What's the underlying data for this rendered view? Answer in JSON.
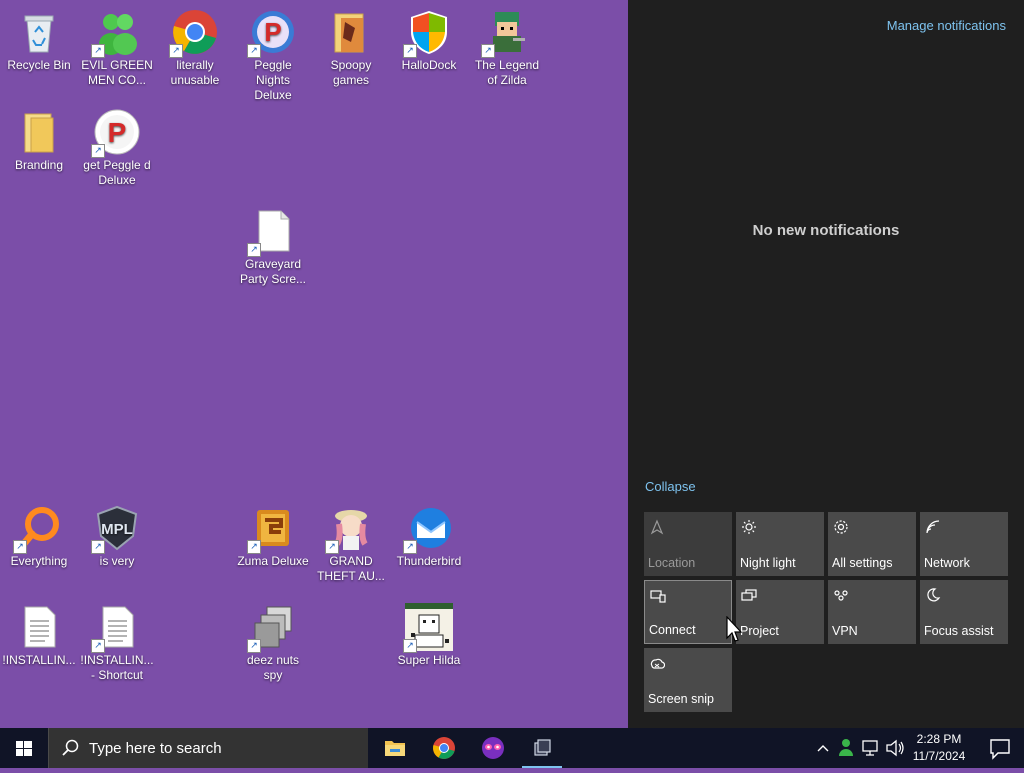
{
  "desktop": {
    "icons": [
      {
        "label": "Recycle Bin",
        "icon": "recycle-bin-icon"
      },
      {
        "label": "EVIL GREEN MEN CO...",
        "icon": "green-men-icon"
      },
      {
        "label": "literally unusable",
        "icon": "chrome-icon"
      },
      {
        "label": "Peggle Nights Deluxe",
        "icon": "peggle-icon"
      },
      {
        "label": "Spoopy games",
        "icon": "folder-icon"
      },
      {
        "label": "HalloDock",
        "icon": "windows-shield-icon"
      },
      {
        "label": "The Legend of Zilda",
        "icon": "zilda-icon"
      },
      {
        "label": "Branding",
        "icon": "folder-icon"
      },
      {
        "label": "get Peggle d Deluxe",
        "icon": "peggle-icon"
      },
      {
        "label": "Graveyard Party Scre...",
        "icon": "file-icon"
      },
      {
        "label": "Everything",
        "icon": "magnifier-icon"
      },
      {
        "label": "is very",
        "icon": "shield-badge-icon"
      },
      {
        "label": "Zuma Deluxe",
        "icon": "zuma-icon"
      },
      {
        "label": "GRAND THEFT AU...",
        "icon": "anime-icon"
      },
      {
        "label": "Thunderbird",
        "icon": "thunderbird-icon"
      },
      {
        "label": "!INSTALLIN...",
        "icon": "text-file-icon"
      },
      {
        "label": "!INSTALLIN... - Shortcut",
        "icon": "text-file-icon"
      },
      {
        "label": "deez nuts spy",
        "icon": "stack-icon"
      },
      {
        "label": "Super Hilda",
        "icon": "pixel-art-icon"
      }
    ]
  },
  "action_center": {
    "manage_label": "Manage notifications",
    "empty_label": "No new notifications",
    "collapse_label": "Collapse",
    "tiles": [
      {
        "label": "Location",
        "icon": "location-icon",
        "state": "off"
      },
      {
        "label": "Night light",
        "icon": "brightness-icon",
        "state": "normal"
      },
      {
        "label": "All settings",
        "icon": "gear-icon",
        "state": "normal"
      },
      {
        "label": "Network",
        "icon": "network-icon",
        "state": "normal"
      },
      {
        "label": "Connect",
        "icon": "connect-icon",
        "state": "hover"
      },
      {
        "label": "Project",
        "icon": "project-icon",
        "state": "normal"
      },
      {
        "label": "VPN",
        "icon": "vpn-icon",
        "state": "normal"
      },
      {
        "label": "Focus assist",
        "icon": "moon-icon",
        "state": "normal"
      },
      {
        "label": "Screen snip",
        "icon": "snip-icon",
        "state": "normal"
      }
    ]
  },
  "taskbar": {
    "search_placeholder": "Type here to search",
    "pinned": [
      "file-explorer-icon",
      "chrome-icon",
      "game-mask-icon",
      "task-view-icon"
    ],
    "clock_time": "2:28 PM",
    "clock_date": "11/7/2024"
  },
  "colors": {
    "desktop_bg": "#7b4ea8",
    "panel_bg": "#1f1f1f",
    "accent": "#7ec3ef",
    "tile_bg": "#4a4a4a",
    "taskbar_bg": "#101426"
  }
}
